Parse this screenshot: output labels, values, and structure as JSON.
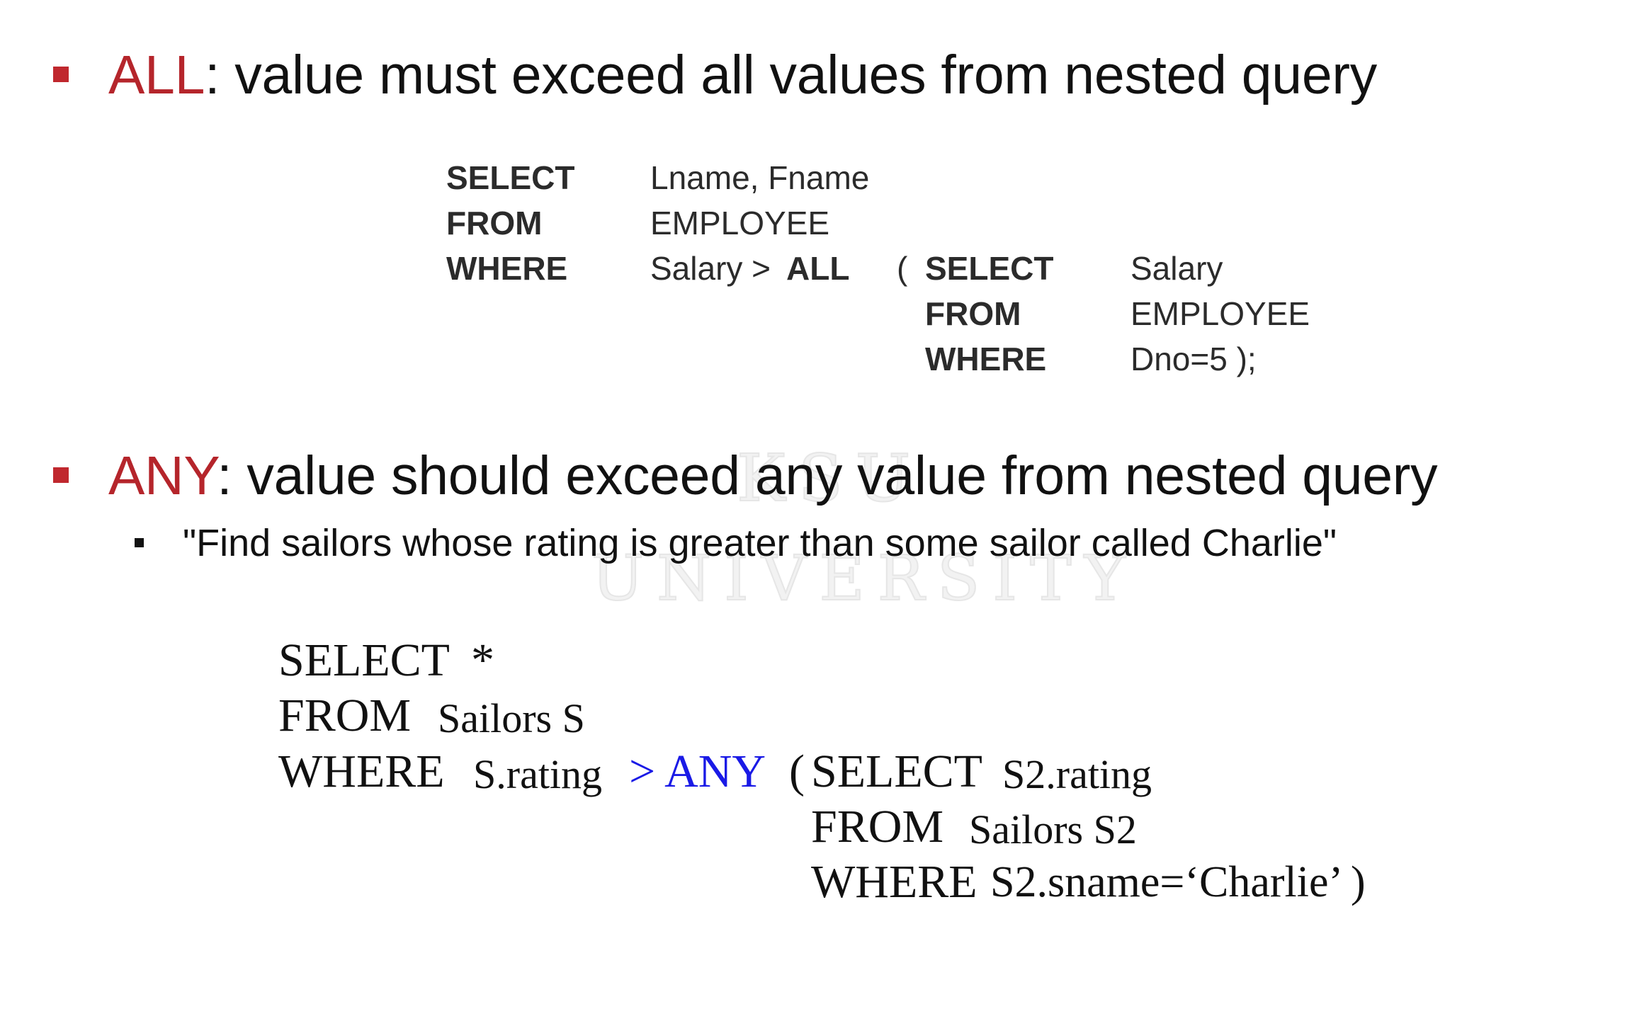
{
  "bullet_all": {
    "keyword": "ALL",
    "text": ": value must exceed all values from nested query"
  },
  "query_all": {
    "line1": {
      "keyword": "SELECT",
      "value": "Lname, Fname"
    },
    "line2": {
      "keyword": "FROM",
      "value": "EMPLOYEE"
    },
    "line3": {
      "keyword": "WHERE",
      "value": "Salary >",
      "operator": "ALL",
      "paren_open": "("
    },
    "sub1": {
      "keyword": "SELECT",
      "value": "Salary"
    },
    "sub2": {
      "keyword": "FROM",
      "value": "EMPLOYEE"
    },
    "sub3": {
      "keyword": "WHERE",
      "value": "Dno=5 );"
    }
  },
  "bullet_any": {
    "keyword": "ANY",
    "text": ": value should exceed any value from nested query"
  },
  "sub_bullet": {
    "text": "\"Find sailors whose rating is greater than some sailor called Charlie\""
  },
  "query_any": {
    "line1": {
      "keyword": "SELECT",
      "value": "*"
    },
    "line2": {
      "keyword": "FROM",
      "value": "Sailors S"
    },
    "line3": {
      "keyword": "WHERE",
      "value": "S.rating",
      "operator": "> ANY",
      "paren_open": "("
    },
    "sub1": {
      "keyword": "SELECT",
      "value": "S2.rating"
    },
    "sub2": {
      "keyword": "FROM",
      "value": "Sailors S2"
    },
    "sub3": {
      "keyword": "WHERE",
      "value": "S2.sname=‘Charlie’ )"
    }
  },
  "watermark": {
    "line1": "KSU",
    "line2": "UNIVERSITY"
  },
  "colors": {
    "accent_red": "#b5252b",
    "operator_blue": "#1a1ae6",
    "text": "#111111"
  }
}
